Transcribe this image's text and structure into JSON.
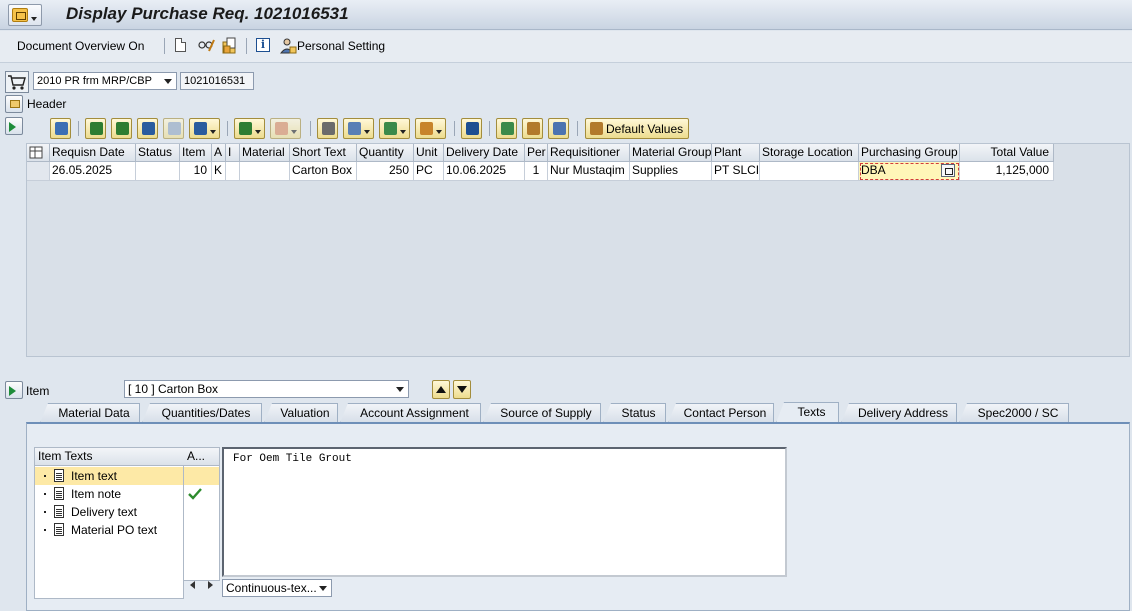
{
  "window": {
    "title": "Display Purchase Req. 1021016531"
  },
  "toolbar": {
    "document_overview": "Document Overview On",
    "personal_setting": "Personal Setting"
  },
  "header": {
    "doc_type": "2010 PR frm MRP/CBP",
    "pr_number": "1021016531",
    "header_label": "Header"
  },
  "grid_toolbar": {
    "default_values": "Default Values"
  },
  "grid": {
    "columns": [
      "Requisn Date",
      "Status",
      "Item",
      "A",
      "I",
      "Material",
      "Short Text",
      "Quantity",
      "Unit",
      "Delivery Date",
      "Per",
      "Requisitioner",
      "Material Group",
      "Plant",
      "Storage Location",
      "Purchasing Group",
      "Total Value"
    ],
    "rows": [
      [
        "26.05.2025",
        "",
        "10",
        "K",
        "",
        "",
        "Carton Box",
        "250",
        "PC",
        "10.06.2025",
        "1",
        "Nur Mustaqim",
        "Supplies",
        "PT SLCI",
        "",
        "DBA",
        "1,125,000"
      ]
    ]
  },
  "item_selector": {
    "label": "Item",
    "value": "[ 10 ] Carton Box"
  },
  "tabs": [
    "Material Data",
    "Quantities/Dates",
    "Valuation",
    "Account Assignment",
    "Source of Supply",
    "Status",
    "Contact Person",
    "Texts",
    "Delivery Address",
    "Spec2000 / SC"
  ],
  "active_tab": "Texts",
  "texts": {
    "tree_header": "Item Texts",
    "active_header": "A...",
    "items": [
      "Item text",
      "Item note",
      "Delivery text",
      "Material PO text"
    ],
    "selected": "Item text",
    "editor_content": "For Oem Tile Grout",
    "mode": "Continuous-tex..."
  },
  "colors": {
    "selection": "#fde9a6",
    "focus_cell": "#fff6b8",
    "tab_accent": "#6e8fb8"
  }
}
